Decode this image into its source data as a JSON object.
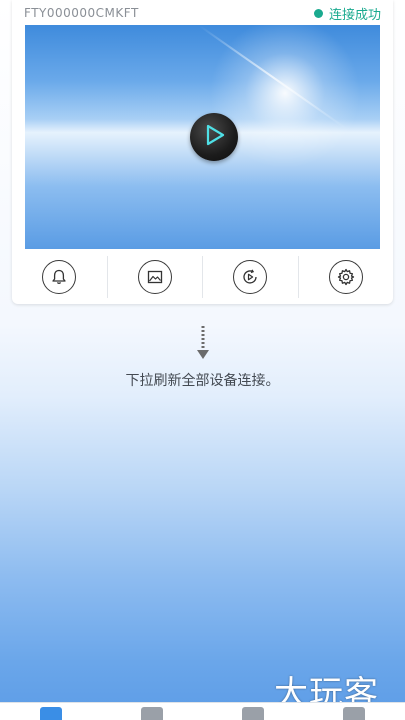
{
  "camera_card": {
    "device_id": "FTY000000CMKFT",
    "status_text": "连接成功",
    "status_color": "#1aaa8f",
    "play_icon": "play-icon"
  },
  "actions": [
    {
      "name": "alarm",
      "icon": "bell-icon"
    },
    {
      "name": "album",
      "icon": "picture-icon"
    },
    {
      "name": "playback",
      "icon": "replay-icon"
    },
    {
      "name": "settings",
      "icon": "gear-icon"
    }
  ],
  "pull_refresh": {
    "text": "下拉刷新全部设备连接。",
    "icon": "arrow-down-icon"
  },
  "watermark": "大玩客",
  "tabbar": {
    "tabs": [
      "camera-tab-icon",
      "image-tab-icon",
      "film-tab-icon",
      "profile-tab-icon"
    ],
    "active_index": 0,
    "accent": "#3a8ee6"
  }
}
